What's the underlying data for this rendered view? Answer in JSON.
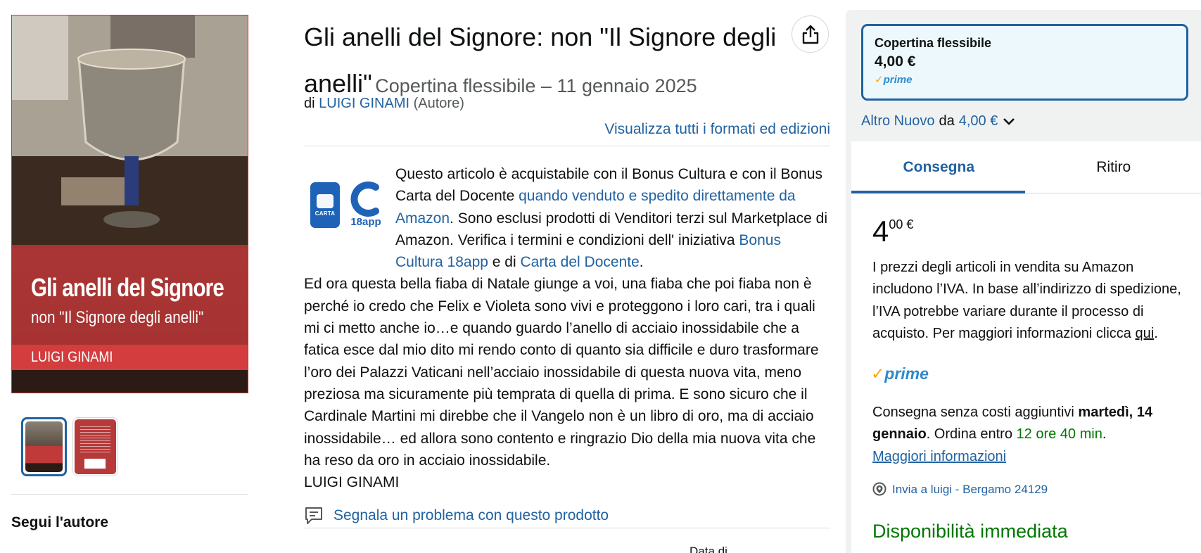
{
  "cover": {
    "title": "Gli anelli del Signore",
    "subtitle": "non \"Il Signore degli anelli\"",
    "author": "LUIGI GINAMI"
  },
  "thumbnails": [
    {
      "name": "front-cover",
      "selected": true
    },
    {
      "name": "back-cover",
      "selected": false
    }
  ],
  "left": {
    "follow_author": "Segui l'autore"
  },
  "product": {
    "title": "Gli anelli del Signore: non \"Il Signore degli anelli\"",
    "format_date": "Copertina flessibile – 11 gennaio 2025",
    "by_prefix": "di",
    "author": "LUIGI GINAMI",
    "author_role": "(Autore)",
    "all_formats_link": "Visualizza tutti i formati ed edizioni"
  },
  "bonus": {
    "carta_logo_text": "CARTA",
    "app_logo_text": "18app",
    "text_1": "Questo articolo è acquistabile con il Bonus Cultura e con il Bonus Carta del Docente",
    "link_1": "quando venduto e spedito direttamente da Amazon",
    "text_2": ". Sono esclusi prodotti di Venditori terzi sul Marketplace di Amazon. Verifica i termini e condizioni dell' iniziativa",
    "link_2": "Bonus Cultura 18app",
    "text_3": "e di",
    "link_3": "Carta del Docente",
    "text_4": "."
  },
  "description": {
    "text": "Ed ora questa bella fiaba di Natale giunge a voi, una fiaba che poi fiaba non è perché io credo che Felix e Violeta sono vivi e proteggono i loro cari, tra i quali mi ci metto anche io…e quando guardo l’anello di acciaio inossidabile che a fatica esce dal mio dito mi rendo conto di quanto sia difficile e duro trasformare l’oro dei Palazzi Vaticani nell’acciaio inossidabile di questa nuova vita, meno preziosa ma sicuramente più temprata di quella di prima. E sono sicuro che il Cardinale Martini mi direbbe che il Vangelo non è un libro di oro, ma di acciaio inossidabile… ed allora sono contento e ringrazio Dio della mia nuova vita che ha reso da oro in acciaio inossidabile.",
    "signature": "LUIGI GINAMI"
  },
  "report_problem": "Segnala un problema con questo prodotto",
  "detail_label_partial": "Data di",
  "buybox": {
    "format_name": "Copertina flessibile",
    "format_price": "4,00 €",
    "prime_label": "prime",
    "altro_prefix": "Altro Nuovo",
    "altro_da": "da",
    "altro_price": "4,00 €",
    "tabs": [
      {
        "label": "Consegna",
        "active": true
      },
      {
        "label": "Ritiro",
        "active": false
      }
    ],
    "price_whole": "4",
    "price_frac": "00 €",
    "vat_text": "I prezzi degli articoli in vendita su Amazon includono l’IVA. In base all’indirizzo di spedizione, l’IVA potrebbe variare durante il processo di acquisto. Per maggiori informazioni clicca",
    "vat_link": "qui",
    "vat_end": ".",
    "delivery_prefix": "Consegna senza costi aggiuntivi",
    "delivery_date": "martedì, 14 gennaio",
    "order_within_prefix": ". Ordina entro",
    "order_within_time": "12 ore 40 min",
    "order_within_end": ".",
    "more_info": "Maggiori informazioni",
    "ship_to": "Invia a luigi - Bergamo 24129",
    "availability": "Disponibilità immediata"
  },
  "colors": {
    "link": "#2162a1",
    "green": "#007600",
    "prime_blue": "#2d8bc9",
    "prime_check": "#f7a700",
    "selected_border": "#2162a1",
    "cover_red": "#c03a3a"
  }
}
